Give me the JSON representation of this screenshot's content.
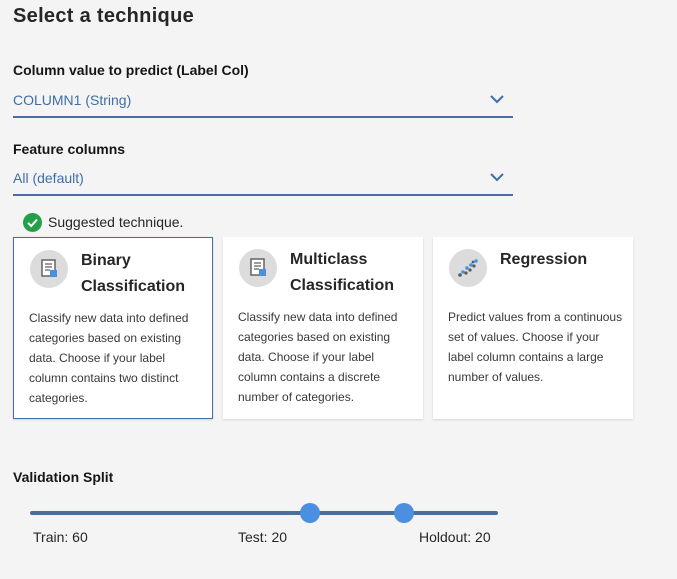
{
  "page": {
    "title": "Select a technique"
  },
  "label_column": {
    "label": "Column value to predict (Label Col)",
    "value": "COLUMN1 (String)"
  },
  "feature_columns": {
    "label": "Feature columns",
    "value": "All (default)"
  },
  "suggestion": {
    "text": "Suggested technique."
  },
  "techniques": [
    {
      "title_line1": "Binary",
      "title_line2": "Classification",
      "description": "Classify new data into defined categories based on existing data. Choose if your label column contains two distinct categories.",
      "icon": "document-icon",
      "selected": true
    },
    {
      "title_line1": "Multiclass",
      "title_line2": "Classification",
      "description": "Classify new data into defined categories based on existing data. Choose if your label column contains a discrete number of categories.",
      "icon": "document-icon",
      "selected": false
    },
    {
      "title_line1": "Regression",
      "title_line2": "",
      "description": "Predict values from a continuous set of values. Choose if your label column contains a large number of values.",
      "icon": "scatter-plot-icon",
      "selected": false
    }
  ],
  "validation_split": {
    "label": "Validation Split",
    "train_label": "Train: 60",
    "test_label": "Test: 20",
    "holdout_label": "Holdout: 20",
    "train": 60,
    "test": 20,
    "holdout": 20
  },
  "colors": {
    "accent": "#3f6ea8",
    "thumb": "#4a8fe0",
    "success": "#24a148",
    "background": "#f4f4f4"
  }
}
